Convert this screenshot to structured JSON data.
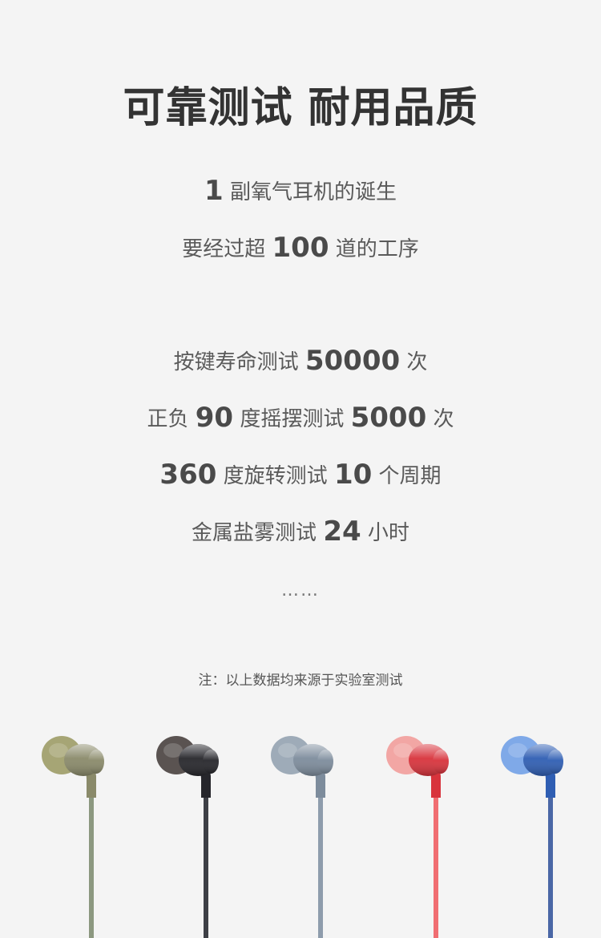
{
  "title": "可靠测试 耐用品质",
  "intro": [
    {
      "num": "1",
      "text": "副氧气耳机的诞生"
    },
    {
      "pre": "要经过超",
      "num": "100",
      "post": "道的工序"
    }
  ],
  "tests": [
    {
      "pre": "按键寿命测试",
      "num": "50000",
      "post": "次"
    },
    {
      "pre": "正负",
      "num1": "90",
      "mid": "度摇摆测试",
      "num2": "5000",
      "post": "次"
    },
    {
      "num1": "360",
      "mid": "度旋转测试",
      "num2": "10",
      "post": "个周期"
    },
    {
      "pre": "金属盐雾测试",
      "num": "24",
      "post": "小时"
    }
  ],
  "ellipsis": "……",
  "note": "注：以上数据均来源于实验室测试",
  "earphones": [
    {
      "name": "olive",
      "tip": "#a6a575",
      "body": "#8a8a6a",
      "cable": "#8c9880"
    },
    {
      "name": "black",
      "tip": "#5a5351",
      "body": "#26262b",
      "cable": "#3e4046"
    },
    {
      "name": "grey-blue",
      "tip": "#9eabb8",
      "body": "#7d8c9c",
      "cable": "#8e9cac"
    },
    {
      "name": "red",
      "tip": "#f2a6a4",
      "body": "#d8333c",
      "cable": "#f06e72"
    },
    {
      "name": "blue",
      "tip": "#7fa9e8",
      "body": "#2f5eb3",
      "cable": "#4a67a6"
    }
  ]
}
